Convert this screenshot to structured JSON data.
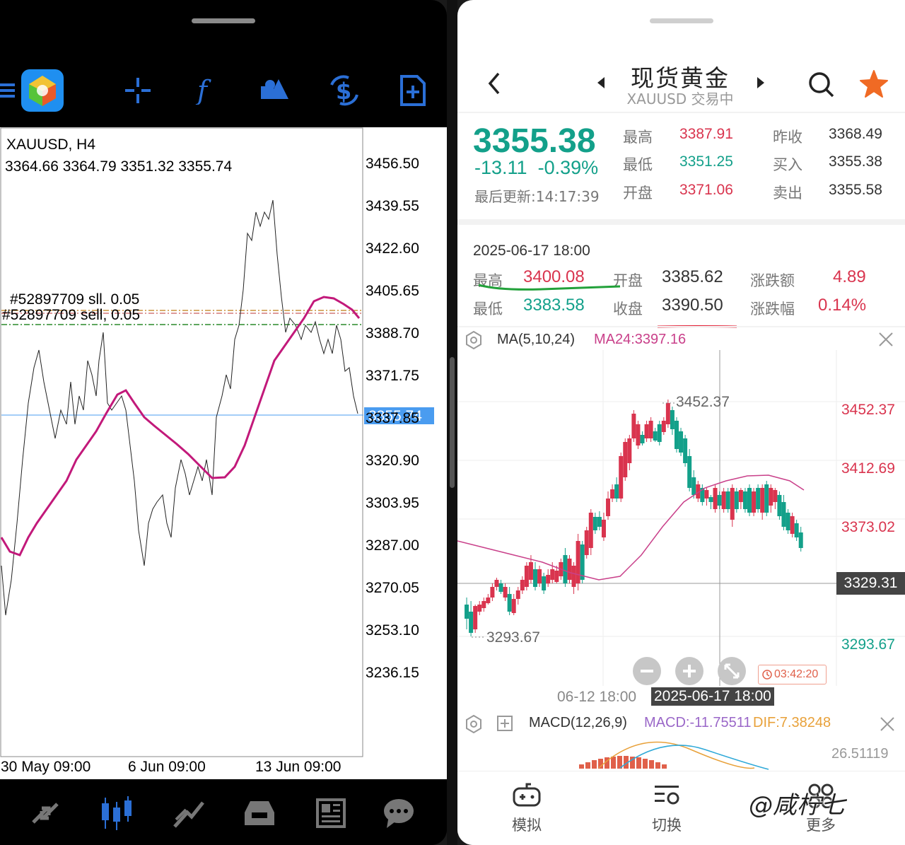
{
  "left": {
    "symbol_tf": "XAUUSD, H4",
    "ohlc": "3364.66 3364.79 3351.32 3355.74",
    "price_axis": [
      "3456.50",
      "3439.55",
      "3422.60",
      "3405.65",
      "3388.70",
      "3371.75",
      "3355.74",
      "3337.85",
      "3320.90",
      "3303.95",
      "3287.00",
      "3270.05",
      "3253.10",
      "3236.15"
    ],
    "current_price": "3355.74",
    "order_line_1": "#52897709 sll. 0.05",
    "order_line_2": "#52897709 sell, 0.05",
    "time_axis": [
      "30 May 09:00",
      "6 Jun 09:00",
      "13 Jun 09:00"
    ],
    "toolbar_icons": [
      "menu-icon",
      "metatrader-logo",
      "crosshair-icon",
      "indicators-icon",
      "objects-icon",
      "trade-icon",
      "new-order-icon"
    ],
    "bottom_icons": [
      "quotes-icon",
      "chart-icon",
      "trade-icon",
      "history-icon",
      "news-icon",
      "chat-icon"
    ],
    "colors": {
      "ma": "#c2197a",
      "accent": "#2b6fd6",
      "price_tag": "#4a9cf0"
    }
  },
  "right": {
    "title": "现货黄金",
    "subtitle": "XAUUSD 交易中",
    "price": "3355.38",
    "change": "-13.11",
    "change_pct": "-0.39%",
    "last_update": "最后更新:14:17:39",
    "quote_labels": {
      "high": "最高",
      "low": "最低",
      "open": "开盘",
      "prev_close": "昨收",
      "bid": "买入",
      "ask": "卖出"
    },
    "quote_values": {
      "high": "3387.91",
      "low": "3351.25",
      "open": "3371.06",
      "prev_close": "3368.49",
      "bid": "3355.38",
      "ask": "3355.58"
    },
    "bar_time": "2025-06-17 18:00",
    "bar_labels": {
      "high": "最高",
      "low": "最低",
      "open": "开盘",
      "close": "收盘",
      "chg_amt": "涨跌额",
      "chg_pct": "涨跌幅"
    },
    "bar_values": {
      "high": "3400.08",
      "low": "3383.58",
      "open": "3385.62",
      "close": "3390.50",
      "chg_amt": "4.89",
      "chg_pct": "0.14%"
    },
    "ma_label": "MA(5,10,24)",
    "ma24_label": "MA24:3397.16",
    "price_axis": [
      "3452.37",
      "3412.69",
      "3373.02",
      "3293.67"
    ],
    "crosshair_price": "3329.31",
    "high_marker": "3452.37",
    "low_marker": "3293.67",
    "timer": "03:42:20",
    "time_axis_left": "06-12 18:00",
    "time_axis_cursor": "2025-06-17 18:00",
    "macd_label": "MACD(12,26,9)",
    "macd_value": "MACD:-11.75511",
    "dif_value": "DIF:7.38248",
    "macd_axis": "26.51119",
    "nav": [
      "模拟",
      "切换",
      "更多"
    ],
    "watermark": "@咸柠七",
    "colors": {
      "up": "#d9344e",
      "down": "#13a08a",
      "ma24": "#c9408a",
      "dif": "#e8a13a",
      "dea": "#2fa9d8"
    }
  }
}
